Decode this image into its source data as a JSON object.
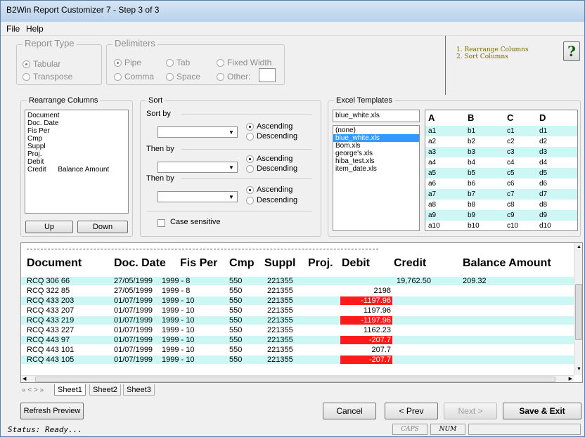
{
  "window": {
    "title": "B2Win Report Customizer 7 - Step 3 of 3"
  },
  "menu": {
    "file": "File",
    "help": "Help"
  },
  "report_type": {
    "legend": "Report Type",
    "options": [
      "Tabular",
      "Transpose"
    ],
    "selected": "Tabular"
  },
  "delimiters": {
    "legend": "Delimiters",
    "pipe": "Pipe",
    "tab": "Tab",
    "fixed_width": "Fixed Width",
    "comma": "Comma",
    "space": "Space",
    "other": "Other:",
    "selected": "Pipe"
  },
  "steps_help": {
    "steps": [
      "1. Rearrange Columns",
      "2. Sort Columns"
    ],
    "help_glyph": "?"
  },
  "rearrange": {
    "legend": "Rearrange Columns",
    "items": [
      "Document",
      "Doc. Date",
      "Fis Per",
      "Cmp",
      "Suppl",
      "Proj.",
      "Debit",
      "Credit      Balance Amount"
    ],
    "up_label": "Up",
    "down_label": "Down"
  },
  "sort": {
    "legend": "Sort",
    "sort_by": "Sort by",
    "then_by_1": "Then by",
    "then_by_2": "Then by",
    "ascending": "Ascending",
    "descending": "Descending",
    "case_sensitive": "Case sensitive"
  },
  "excel_templates": {
    "legend": "Excel Templates",
    "selected_file": "blue_white.xls",
    "files": [
      "(none)",
      "blue_white.xls",
      "Bom.xls",
      "george's.xls",
      "hiba_test.xls",
      "item_date.xls"
    ],
    "selected_index": 1,
    "preview_headers": [
      "A",
      "B",
      "C",
      "D"
    ],
    "preview_rows": [
      [
        "a1",
        "b1",
        "c1",
        "d1"
      ],
      [
        "a2",
        "b2",
        "c2",
        "d2"
      ],
      [
        "a3",
        "b3",
        "c3",
        "d3"
      ],
      [
        "a4",
        "b4",
        "c4",
        "d4"
      ],
      [
        "a5",
        "b5",
        "c5",
        "d5"
      ],
      [
        "a6",
        "b6",
        "c6",
        "d6"
      ],
      [
        "a7",
        "b7",
        "c7",
        "d7"
      ],
      [
        "a8",
        "b8",
        "c8",
        "d8"
      ],
      [
        "a9",
        "b9",
        "c9",
        "d9"
      ],
      [
        "a10",
        "b10",
        "c10",
        "d10"
      ]
    ]
  },
  "preview": {
    "headers": [
      "Document",
      "Doc. Date",
      "Fis Per",
      "Cmp",
      "Suppl",
      "Proj.",
      "Debit",
      "Credit",
      "Balance Amount"
    ],
    "rows": [
      {
        "doc": "RCQ     306    66",
        "date": "27/05/1999",
        "fis": "1999 -  8",
        "cmp": "550",
        "suppl": "221355",
        "debit": "",
        "credit": "19,762.50",
        "balance": "209.32",
        "red": false,
        "teal": true
      },
      {
        "doc": "RCQ     322    85",
        "date": "27/05/1999",
        "fis": "1999 -  8",
        "cmp": "550",
        "suppl": "221355",
        "debit": "2198",
        "credit": "",
        "balance": "",
        "red": false,
        "teal": false
      },
      {
        "doc": "RCQ     433   203",
        "date": "01/07/1999",
        "fis": "1999 - 10",
        "cmp": "550",
        "suppl": "221355",
        "debit": "-1197.96",
        "credit": "",
        "balance": "",
        "red": true,
        "teal": true
      },
      {
        "doc": "RCQ     433   207",
        "date": "01/07/1999",
        "fis": "1999 - 10",
        "cmp": "550",
        "suppl": "221355",
        "debit": "1197.96",
        "credit": "",
        "balance": "",
        "red": false,
        "teal": false
      },
      {
        "doc": "RCQ     433   219",
        "date": "01/07/1999",
        "fis": "1999 - 10",
        "cmp": "550",
        "suppl": "221355",
        "debit": "-1197.96",
        "credit": "",
        "balance": "",
        "red": true,
        "teal": true
      },
      {
        "doc": "RCQ     433   227",
        "date": "01/07/1999",
        "fis": "1999 - 10",
        "cmp": "550",
        "suppl": "221355",
        "debit": "1162.23",
        "credit": "",
        "balance": "",
        "red": false,
        "teal": false
      },
      {
        "doc": "RCQ     443    97",
        "date": "01/07/1999",
        "fis": "1999 - 10",
        "cmp": "550",
        "suppl": "221355",
        "debit": "-207.7",
        "credit": "",
        "balance": "",
        "red": true,
        "teal": true
      },
      {
        "doc": "RCQ     443   101",
        "date": "01/07/1999",
        "fis": "1999 - 10",
        "cmp": "550",
        "suppl": "221355",
        "debit": "207.7",
        "credit": "",
        "balance": "",
        "red": false,
        "teal": false
      },
      {
        "doc": "RCQ     443   105",
        "date": "01/07/1999",
        "fis": "1999 - 10",
        "cmp": "550",
        "suppl": "221355",
        "debit": "-207.7",
        "credit": "",
        "balance": "",
        "red": true,
        "teal": true
      }
    ]
  },
  "sheet_tabs": {
    "nav": "« < > »",
    "tabs": [
      "Sheet1",
      "Sheet2",
      "Sheet3"
    ],
    "active": 0
  },
  "buttons": {
    "refresh": "Refresh Preview",
    "cancel": "Cancel",
    "prev": "< Prev",
    "next": "Next >",
    "save_exit": "Save & Exit"
  },
  "status": {
    "text": "Status: Ready...",
    "caps": "CAPS",
    "num": "NUM"
  },
  "colors": {
    "teal_row": "#cdf7f4",
    "negative": "#ff1b1b",
    "selection": "#3399ff"
  }
}
